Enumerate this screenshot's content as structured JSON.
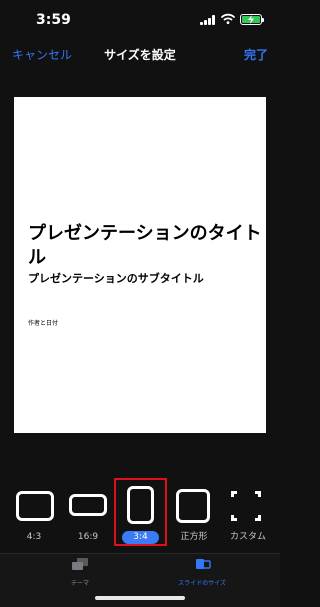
{
  "status_bar": {
    "time": "3:59"
  },
  "nav": {
    "cancel": "キャンセル",
    "title": "サイズを設定",
    "done": "完了"
  },
  "slide": {
    "title": "プレゼンテーションのタイトル",
    "subtitle": "プレゼンテーションのサブタイトル",
    "author": "作者と日付"
  },
  "size_options": [
    {
      "label": "4:3",
      "selected": false
    },
    {
      "label": "16:9",
      "selected": false
    },
    {
      "label": "3:4",
      "selected": true
    },
    {
      "label": "正方形",
      "selected": false
    },
    {
      "label": "カスタム",
      "selected": false
    }
  ],
  "tabs": [
    {
      "label": "テーマ",
      "icon": "theme-icon",
      "active": false
    },
    {
      "label": "スライドのサイズ",
      "icon": "slide-size-icon",
      "active": true
    }
  ],
  "colors": {
    "accent": "#3478f6",
    "background": "#111112",
    "selection_frame": "#e0101a",
    "selected_badge": "#3a7bf6"
  }
}
